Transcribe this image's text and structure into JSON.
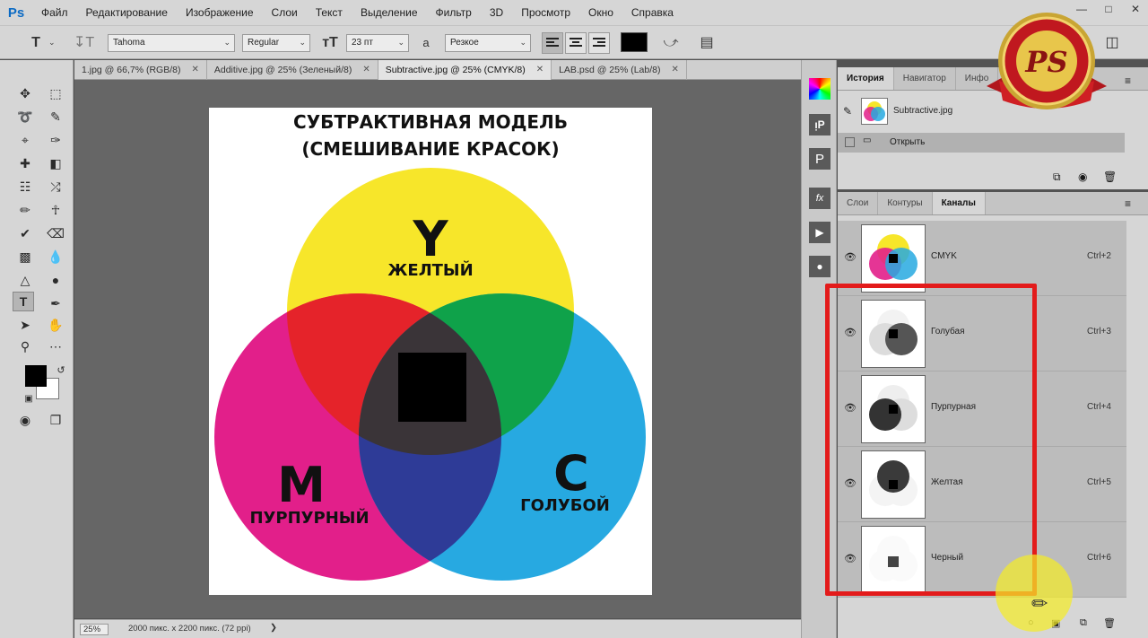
{
  "app": {
    "logo": "Ps",
    "menu": [
      "Файл",
      "Редактирование",
      "Изображение",
      "Слои",
      "Текст",
      "Выделение",
      "Фильтр",
      "3D",
      "Просмотр",
      "Окно",
      "Справка"
    ]
  },
  "options_bar": {
    "font_family": "Tahoma",
    "font_style": "Regular",
    "font_size": "23 пт",
    "aa_label": "а",
    "anti_alias": "Резкое",
    "color": "#000000"
  },
  "tabs": [
    {
      "label": "1.jpg @ 66,7% (RGB/8)"
    },
    {
      "label": "Additive.jpg @ 25% (Зеленый/8)"
    },
    {
      "label": "Subtractive.jpg @ 25% (CMYK/8)"
    },
    {
      "label": "LAB.psd @ 25% (Lab/8)"
    }
  ],
  "document": {
    "title_line1": "СУБТРАКТИВНАЯ МОДЕЛЬ",
    "title_line2": "(СМЕШИВАНИЕ КРАСОК)",
    "yellow_letter": "Y",
    "yellow_label": "ЖЕЛТЫЙ",
    "magenta_letter": "M",
    "magenta_label": "ПУРПУРНЫЙ",
    "cyan_letter": "C",
    "cyan_label": "ГОЛУБОЙ",
    "colors": {
      "yellow": "#f7e62a",
      "magenta": "#e21f8a",
      "cyan": "#27a9e1"
    }
  },
  "status": {
    "zoom": "25%",
    "info": "2000 пикс. x 2200 пикс. (72 ppi)"
  },
  "history_panel": {
    "tabs": [
      "История",
      "Навигатор",
      "Инфо"
    ],
    "snapshot": "Subtractive.jpg",
    "steps": [
      "Открыть"
    ]
  },
  "channels_panel": {
    "tabs": [
      "Слои",
      "Контуры",
      "Каналы"
    ],
    "channels": [
      {
        "name": "CMYK",
        "shortcut": "Ctrl+2"
      },
      {
        "name": "Голубая",
        "shortcut": "Ctrl+3"
      },
      {
        "name": "Пурпурная",
        "shortcut": "Ctrl+4"
      },
      {
        "name": "Желтая",
        "shortcut": "Ctrl+5"
      },
      {
        "name": "Черный",
        "shortcut": "Ctrl+6"
      }
    ]
  },
  "badge": {
    "text": "PS"
  },
  "highlight_color": "#e31b1b"
}
